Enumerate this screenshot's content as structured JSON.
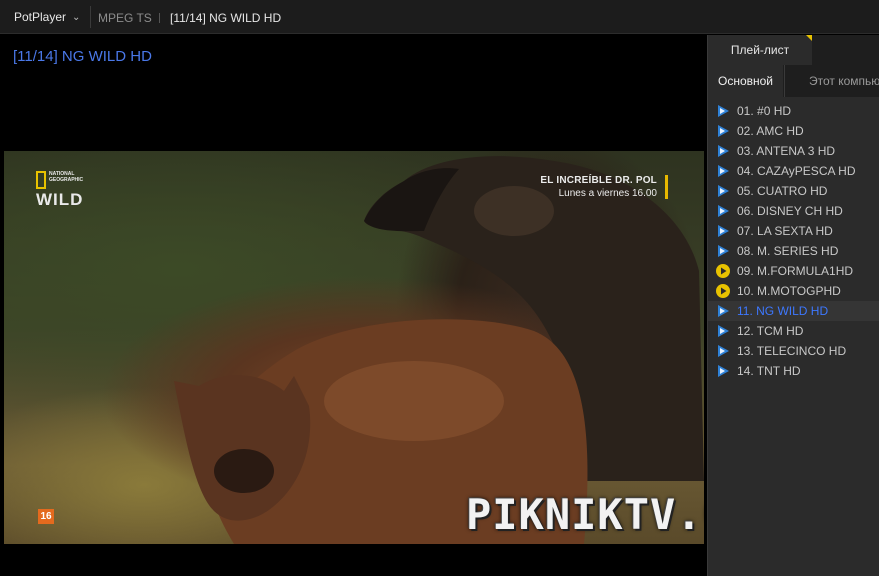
{
  "titlebar": {
    "app_name": "PotPlayer",
    "format": "MPEG TS",
    "title": "[11/14] NG WILD HD"
  },
  "video": {
    "osd_title": "[11/14] NG WILD HD",
    "channel_logo": {
      "small_text": "NATIONAL GEOGRAPHIC",
      "big_text": "WILD"
    },
    "promo_line1": "EL INCREÍBLE DR. POL",
    "promo_line2": "Lunes a viernes 16.00",
    "age_rating": "16",
    "watermark": "PIKNIKTV.COM"
  },
  "playlist": {
    "tab_label": "Плей-лист",
    "subtabs": [
      "Основной",
      "Этот компьютер"
    ],
    "active_subtab": 0,
    "items": [
      {
        "label": "01. #0 HD",
        "icon": "play-triangle-icon"
      },
      {
        "label": "02. AMC HD",
        "icon": "play-triangle-icon"
      },
      {
        "label": "03. ANTENA 3 HD",
        "icon": "play-triangle-icon"
      },
      {
        "label": "04. CAZAyPESCA HD",
        "icon": "play-triangle-icon"
      },
      {
        "label": "05. CUATRO HD",
        "icon": "play-triangle-icon"
      },
      {
        "label": "06. DISNEY CH HD",
        "icon": "play-triangle-icon"
      },
      {
        "label": "07. LA SEXTA HD",
        "icon": "play-triangle-icon"
      },
      {
        "label": "08. M. SERIES HD",
        "icon": "play-triangle-icon"
      },
      {
        "label": "09. M.FORMULA1HD",
        "icon": "play-circle-icon"
      },
      {
        "label": "10. M.MOTOGPHD",
        "icon": "play-circle-icon"
      },
      {
        "label": "11. NG WILD HD",
        "icon": "play-triangle-icon",
        "selected": true
      },
      {
        "label": "12. TCM HD",
        "icon": "play-triangle-icon"
      },
      {
        "label": "13. TELECINCO HD",
        "icon": "play-triangle-icon"
      },
      {
        "label": "14. TNT HD",
        "icon": "play-triangle-icon"
      }
    ]
  },
  "colors": {
    "accent_blue": "#3d78ff",
    "osd_blue": "#4a78e8",
    "accent_yellow": "#e7c200"
  }
}
